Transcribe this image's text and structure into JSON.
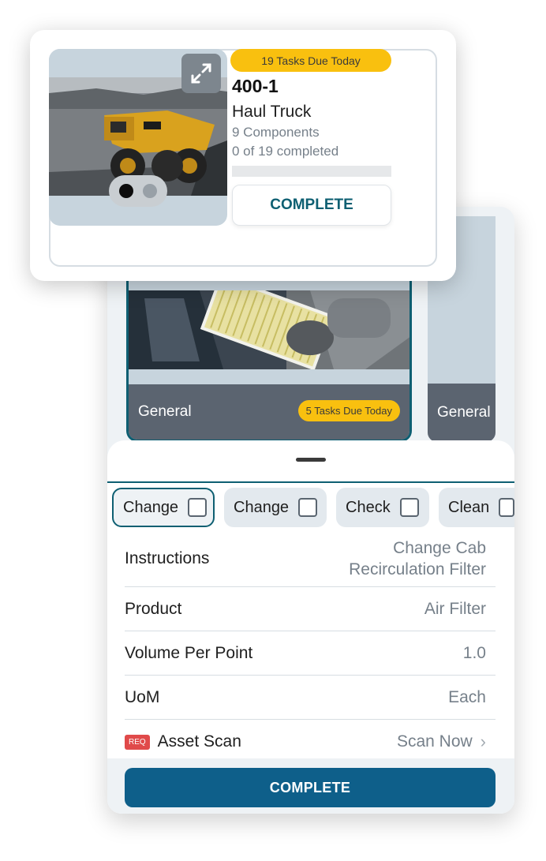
{
  "asset_card": {
    "tasks_due": "19 Tasks Due Today",
    "asset_id": "400-1",
    "asset_type": "Haul Truck",
    "components": "9 Components",
    "progress_text": "0 of 19 completed",
    "progress_fraction": 0,
    "complete_label": "COMPLETE",
    "carousel_dots": 2,
    "active_dot": 1
  },
  "components": [
    {
      "name": "General",
      "tasks_due": "5 Tasks Due Today"
    },
    {
      "name": "General"
    }
  ],
  "task_tabs": [
    {
      "label": "Change",
      "active": true
    },
    {
      "label": "Change",
      "active": false
    },
    {
      "label": "Check",
      "active": false
    },
    {
      "label": "Clean",
      "active": false
    }
  ],
  "details": {
    "instructions_label": "Instructions",
    "instructions_value": "Change Cab Recirculation Filter",
    "product_label": "Product",
    "product_value": "Air Filter",
    "volume_label": "Volume Per Point",
    "volume_value": "1.0",
    "uom_label": "UoM",
    "uom_value": "Each",
    "scan_req_badge": "REQ",
    "scan_label": "Asset Scan",
    "scan_value": "Scan Now"
  },
  "bottom": {
    "complete_label": "COMPLETE"
  },
  "colors": {
    "accent": "#0e5f72",
    "primary_button": "#0e5f8a",
    "badge_yellow": "#f9c00f",
    "req_red": "#e04a4a"
  },
  "icons": [
    "expand-icon",
    "chevron-right-icon",
    "checkbox-icon"
  ]
}
